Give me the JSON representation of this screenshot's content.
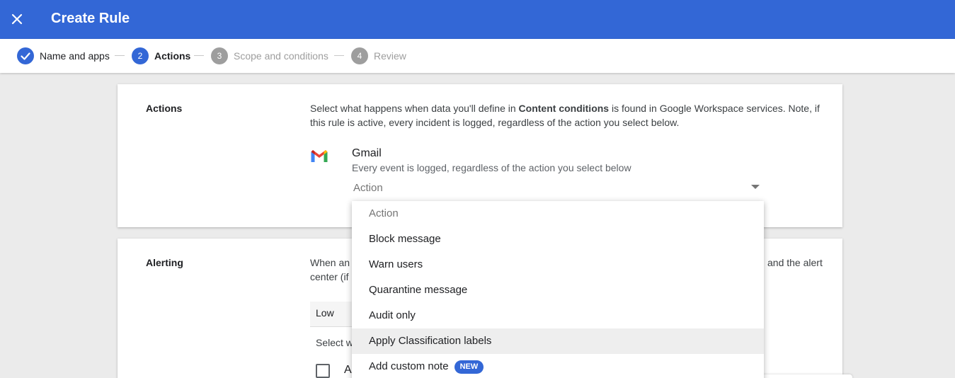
{
  "header": {
    "title": "Create Rule",
    "close_icon": "close-icon"
  },
  "stepper": {
    "steps": [
      {
        "number": "",
        "label": "Name and apps",
        "state": "done"
      },
      {
        "number": "2",
        "label": "Actions",
        "state": "active"
      },
      {
        "number": "3",
        "label": "Scope and conditions",
        "state": "pending"
      },
      {
        "number": "4",
        "label": "Review",
        "state": "pending"
      }
    ]
  },
  "actions_card": {
    "heading": "Actions",
    "desc_pre": "Select what happens when data you'll define in ",
    "desc_bold": "Content conditions",
    "desc_post": " is found in Google Workspace services. Note, if this rule is active, every incident is logged, regardless of the action you select below.",
    "gmail": {
      "name": "Gmail",
      "subtitle": "Every event is logged, regardless of the action you select below",
      "select_value": "Action",
      "icon": "gmail-icon"
    }
  },
  "alerting_card": {
    "heading": "Alerting",
    "desc_left_1": "When an",
    "desc_left_2": "center (if",
    "desc_right": "and the alert",
    "severity": "Low",
    "select_prefix": "Select w",
    "checkbox_label_fragment": "A"
  },
  "dropdown": {
    "options": [
      {
        "label": "Action",
        "placeholder": true
      },
      {
        "label": "Block message"
      },
      {
        "label": "Warn users"
      },
      {
        "label": "Quarantine message"
      },
      {
        "label": "Audit only"
      },
      {
        "label": "Apply Classification labels",
        "hovered": true
      },
      {
        "label": "Add custom note",
        "badge": "NEW"
      }
    ]
  },
  "colors": {
    "accent": "#3367d6",
    "pending": "#9e9e9e",
    "background": "#ebebeb"
  }
}
